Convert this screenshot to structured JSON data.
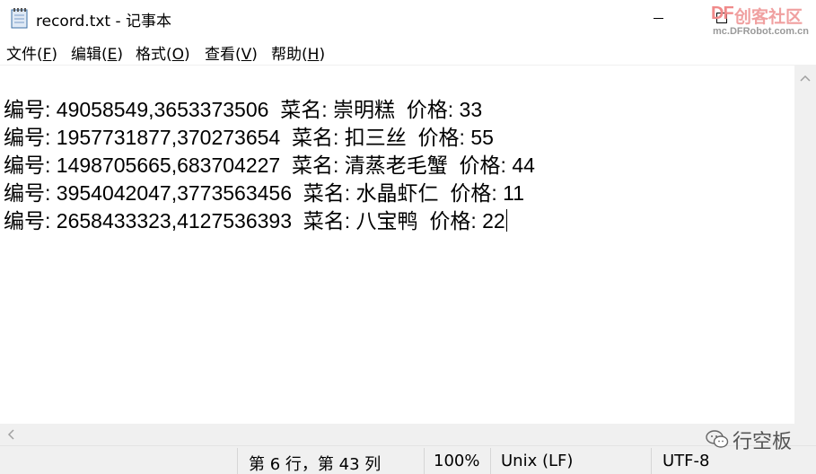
{
  "window": {
    "title": "record.txt - 记事本"
  },
  "watermark": {
    "logo_prefix": "DF",
    "logo_text": "创客社区",
    "url": "mc.DFRobot.com.cn"
  },
  "menu": {
    "items": [
      {
        "label": "文件(",
        "accel": "F",
        "suffix": ")"
      },
      {
        "label": "编辑(",
        "accel": "E",
        "suffix": ")"
      },
      {
        "label": "格式(",
        "accel": "O",
        "suffix": ")"
      },
      {
        "label": "查看(",
        "accel": "V",
        "suffix": ")"
      },
      {
        "label": "帮助(",
        "accel": "H",
        "suffix": ")"
      }
    ]
  },
  "document": {
    "lines": [
      "编号: 49058549,3653373506  菜名: 崇明糕  价格: 33",
      "编号: 1957731877,370273654  菜名: 扣三丝  价格: 55",
      "编号: 1498705665,683704227  菜名: 清蒸老毛蟹  价格: 44",
      "编号: 3954042047,3773563456  菜名: 水晶虾仁  价格: 11",
      "编号: 2658433323,4127536393  菜名: 八宝鸭  价格: 22"
    ]
  },
  "statusbar": {
    "position": "第 6 行，第 43 列",
    "zoom": "100%",
    "line_ending": "Unix (LF)",
    "encoding": "UTF-8"
  },
  "social": {
    "text": "行空板"
  },
  "icons": {
    "app": "notepad-icon",
    "minimize": "minimize-icon",
    "maximize": "maximize-icon",
    "scroll_up": "chevron-up-icon",
    "scroll_left": "chevron-left-icon",
    "social": "wechat-icon"
  }
}
